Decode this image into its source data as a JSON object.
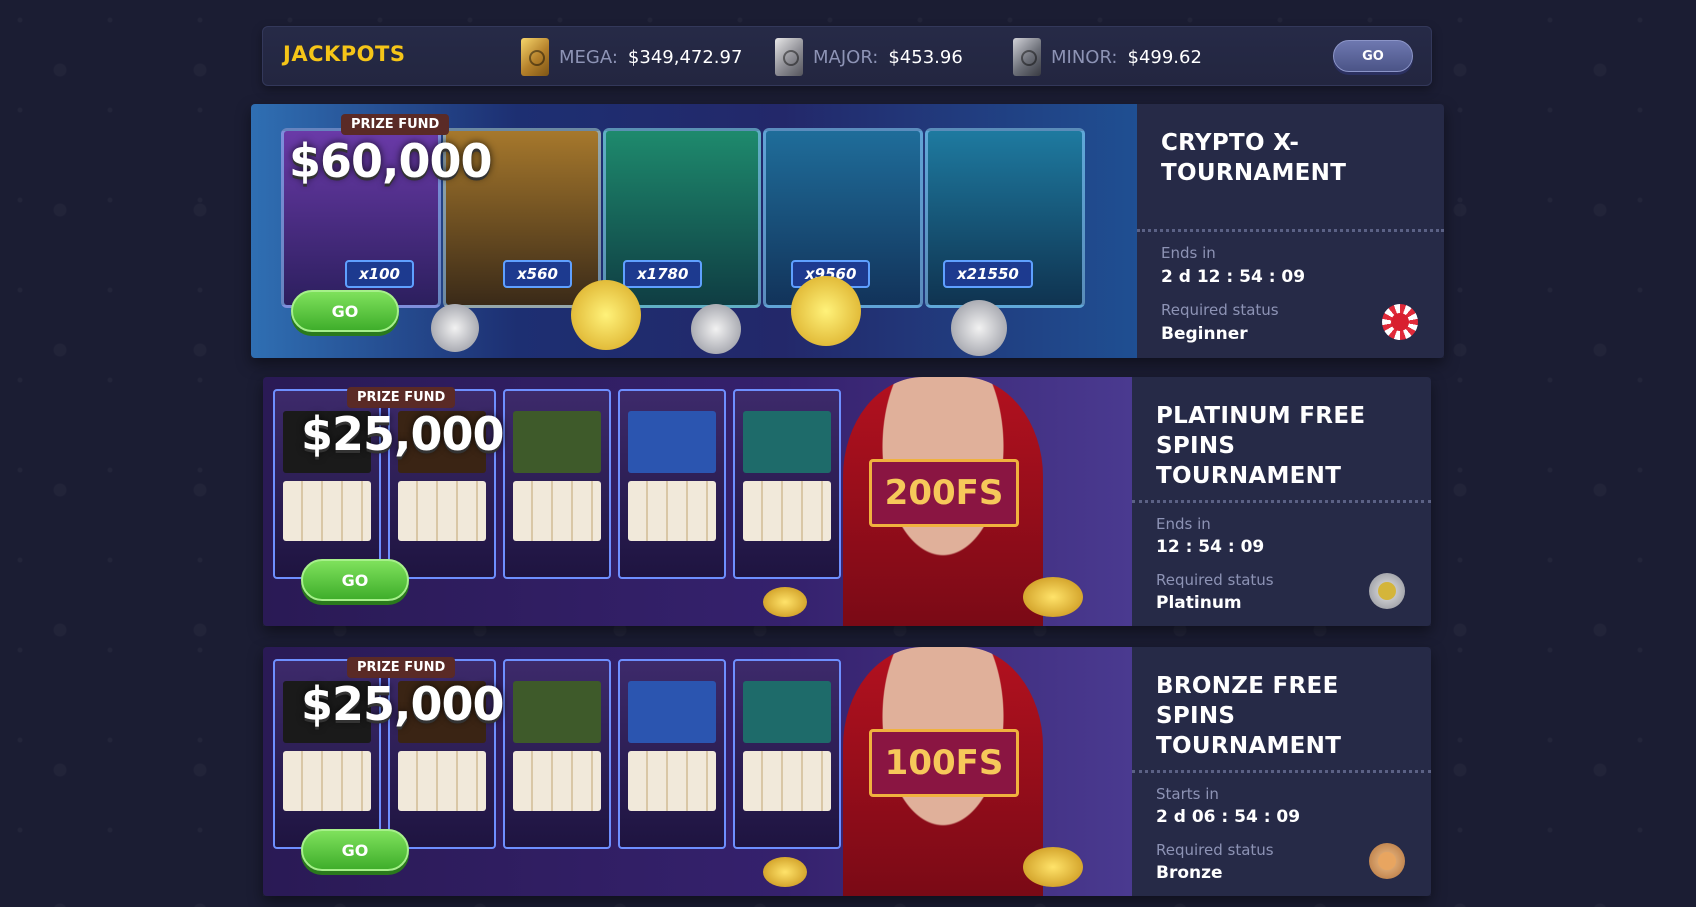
{
  "jackpots": {
    "title": "JACKPOTS",
    "items": [
      {
        "icon": "gold-safe-icon",
        "label": "MEGA:",
        "value": "$349,472.97"
      },
      {
        "icon": "silver-safe-icon",
        "label": "MAJOR:",
        "value": "$453.96"
      },
      {
        "icon": "steel-safe-icon",
        "label": "MINOR:",
        "value": "$499.62"
      }
    ],
    "go_label": "GO"
  },
  "tournaments": [
    {
      "prize_label": "PRIZE FUND",
      "prize_amount": "$60,000",
      "go_label": "GO",
      "multipliers": [
        "x100",
        "x560",
        "x1780",
        "x9560",
        "x21550"
      ],
      "title": "CRYPTO X-TOURNAMENT",
      "time_label": "Ends in",
      "time_value": "2 d 12 : 54 : 09",
      "status_label": "Required status",
      "status_value": "Beginner",
      "status_icon": "beginner-badge-icon"
    },
    {
      "prize_label": "PRIZE FUND",
      "prize_amount": "$25,000",
      "go_label": "GO",
      "sign": "200FS",
      "title": "PLATINUM FREE SPINS TOURNAMENT",
      "time_label": "Ends in",
      "time_value": "12 : 54 : 09",
      "status_label": "Required status",
      "status_value": "Platinum",
      "status_icon": "platinum-badge-icon"
    },
    {
      "prize_label": "PRIZE FUND",
      "prize_amount": "$25,000",
      "go_label": "GO",
      "sign": "100FS",
      "title": "BRONZE FREE SPINS TOURNAMENT",
      "time_label": "Starts in",
      "time_value": "2 d 06 : 54 : 09",
      "status_label": "Required status",
      "status_value": "Bronze",
      "status_icon": "bronze-badge-icon"
    }
  ],
  "colors": {
    "background": "#1b1d33",
    "panel": "#262a47",
    "jackpot_title": "#f5c518",
    "go_green": "#4fc13a",
    "muted_text": "#8d93b5"
  }
}
